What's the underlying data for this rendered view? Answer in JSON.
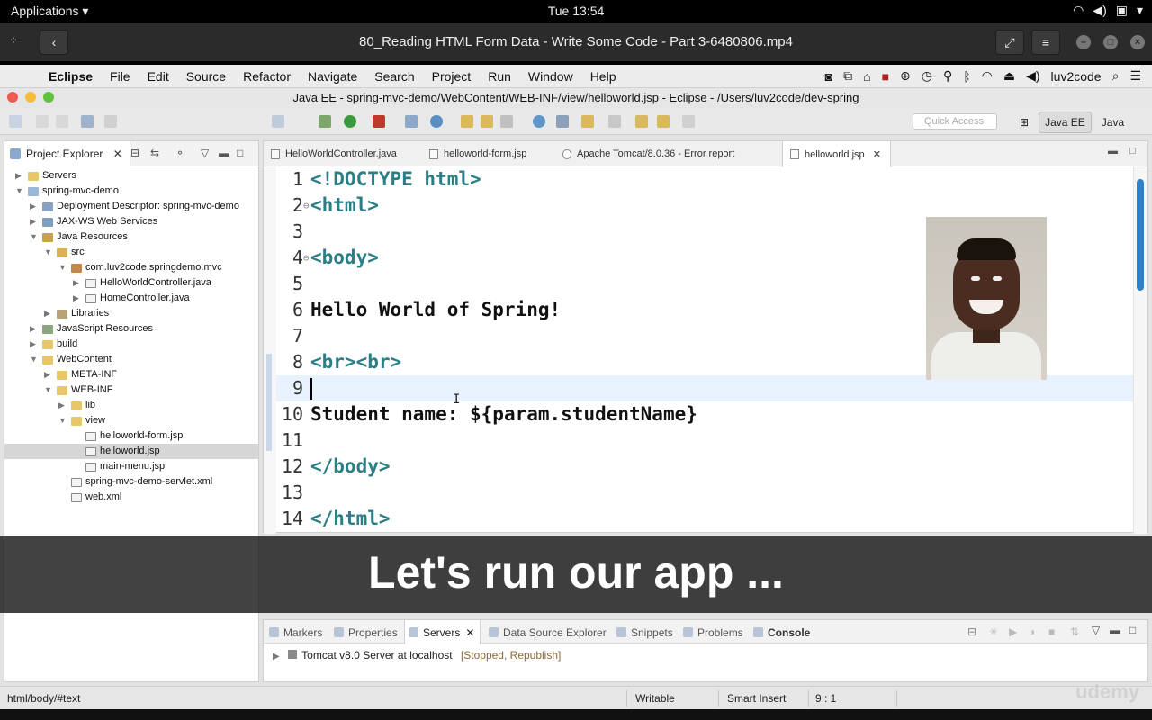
{
  "gnome": {
    "applications_label": "Applications ▾",
    "clock": "Tue 13:54",
    "tray_icons": [
      "wifi-icon",
      "volume-icon",
      "screen-share-icon",
      "power-icon"
    ]
  },
  "player": {
    "title": "80_Reading HTML Form Data - Write Some Code - Part 3-6480806.mp4",
    "back_glyph": "‹",
    "fullscreen_glyph": "⤢",
    "menu_glyph": "≡",
    "drag_glyph": "⁘"
  },
  "mac_menu": {
    "items": [
      "Eclipse",
      "File",
      "Edit",
      "Source",
      "Refactor",
      "Navigate",
      "Search",
      "Project",
      "Run",
      "Window",
      "Help"
    ],
    "user": "luv2code"
  },
  "eclipse": {
    "window_title": "Java EE - spring-mvc-demo/WebContent/WEB-INF/view/helloworld.jsp - Eclipse - /Users/luv2code/dev-spring",
    "quick_access_placeholder": "Quick Access",
    "perspectives": [
      "Java EE",
      "Java"
    ]
  },
  "project_explorer": {
    "tab_label": "Project Explorer",
    "close_glyph": "✕",
    "tree": [
      {
        "label": "Servers",
        "depth": 0,
        "arrow": "▶",
        "icon": "folder-icon"
      },
      {
        "label": "spring-mvc-demo",
        "depth": 0,
        "arrow": "▼",
        "icon": "project-icon"
      },
      {
        "label": "Deployment Descriptor: spring-mvc-demo",
        "depth": 1,
        "arrow": "▶",
        "icon": "descriptor-icon"
      },
      {
        "label": "JAX-WS Web Services",
        "depth": 1,
        "arrow": "▶",
        "icon": "webservice-icon"
      },
      {
        "label": "Java Resources",
        "depth": 1,
        "arrow": "▼",
        "icon": "java-resources-icon"
      },
      {
        "label": "src",
        "depth": 2,
        "arrow": "▼",
        "icon": "source-folder-icon"
      },
      {
        "label": "com.luv2code.springdemo.mvc",
        "depth": 3,
        "arrow": "▼",
        "icon": "package-icon"
      },
      {
        "label": "HelloWorldController.java",
        "depth": 4,
        "arrow": "▶",
        "icon": "java-file-icon"
      },
      {
        "label": "HomeController.java",
        "depth": 4,
        "arrow": "▶",
        "icon": "java-file-icon"
      },
      {
        "label": "Libraries",
        "depth": 2,
        "arrow": "▶",
        "icon": "library-icon"
      },
      {
        "label": "JavaScript Resources",
        "depth": 1,
        "arrow": "▶",
        "icon": "js-resources-icon"
      },
      {
        "label": "build",
        "depth": 1,
        "arrow": "▶",
        "icon": "folder-icon"
      },
      {
        "label": "WebContent",
        "depth": 1,
        "arrow": "▼",
        "icon": "folder-icon"
      },
      {
        "label": "META-INF",
        "depth": 2,
        "arrow": "▶",
        "icon": "folder-icon"
      },
      {
        "label": "WEB-INF",
        "depth": 2,
        "arrow": "▼",
        "icon": "folder-icon"
      },
      {
        "label": "lib",
        "depth": 3,
        "arrow": "▶",
        "icon": "folder-icon"
      },
      {
        "label": "view",
        "depth": 3,
        "arrow": "▼",
        "icon": "folder-icon"
      },
      {
        "label": "helloworld-form.jsp",
        "depth": 4,
        "arrow": "",
        "icon": "jsp-file-icon"
      },
      {
        "label": "helloworld.jsp",
        "depth": 4,
        "arrow": "",
        "icon": "jsp-file-icon",
        "selected": true
      },
      {
        "label": "main-menu.jsp",
        "depth": 4,
        "arrow": "",
        "icon": "jsp-file-icon"
      },
      {
        "label": "spring-mvc-demo-servlet.xml",
        "depth": 3,
        "arrow": "",
        "icon": "xml-file-icon"
      },
      {
        "label": "web.xml",
        "depth": 3,
        "arrow": "",
        "icon": "xml-file-icon"
      }
    ]
  },
  "editor": {
    "tabs": [
      {
        "label": "HelloWorldController.java",
        "active": false
      },
      {
        "label": "helloworld-form.jsp",
        "active": false
      },
      {
        "label": "Apache Tomcat/8.0.36 - Error report",
        "active": false
      },
      {
        "label": "helloworld.jsp",
        "active": true
      }
    ],
    "lines": [
      {
        "n": "1",
        "parts": [
          {
            "t": "<!DOCTYPE html>",
            "c": "tag"
          }
        ]
      },
      {
        "n": "2",
        "fold": true,
        "parts": [
          {
            "t": "<html>",
            "c": "tag"
          }
        ]
      },
      {
        "n": "3",
        "parts": []
      },
      {
        "n": "4",
        "fold": true,
        "parts": [
          {
            "t": "<body>",
            "c": "tag"
          }
        ]
      },
      {
        "n": "5",
        "parts": []
      },
      {
        "n": "6",
        "parts": [
          {
            "t": "Hello World of Spring!",
            "c": "txt"
          }
        ]
      },
      {
        "n": "7",
        "parts": []
      },
      {
        "n": "8",
        "parts": [
          {
            "t": "<br><br>",
            "c": "tag"
          }
        ]
      },
      {
        "n": "9",
        "current": true,
        "parts": []
      },
      {
        "n": "10",
        "parts": [
          {
            "t": "Student name: ",
            "c": "txt"
          },
          {
            "t": "${param.studentName}",
            "c": "txt"
          }
        ]
      },
      {
        "n": "11",
        "parts": []
      },
      {
        "n": "12",
        "parts": [
          {
            "t": "</body>",
            "c": "tag"
          }
        ]
      },
      {
        "n": "13",
        "parts": []
      },
      {
        "n": "14",
        "parts": [
          {
            "t": "</html>",
            "c": "tag"
          }
        ]
      }
    ]
  },
  "subtitle": "Let's run our app ...",
  "bottom_panel": {
    "tabs": [
      {
        "label": "Markers",
        "active": false,
        "bold": false
      },
      {
        "label": "Properties",
        "active": false,
        "bold": false
      },
      {
        "label": "Servers",
        "active": true,
        "bold": false
      },
      {
        "label": "Data Source Explorer",
        "active": false,
        "bold": false
      },
      {
        "label": "Snippets",
        "active": false,
        "bold": false
      },
      {
        "label": "Problems",
        "active": false,
        "bold": false
      },
      {
        "label": "Console",
        "active": false,
        "bold": true
      }
    ],
    "server_name": "Tomcat v8.0 Server at localhost",
    "server_status": "[Stopped, Republish]"
  },
  "status_bar": {
    "path": "html/body/#text",
    "writable": "Writable",
    "insert_mode": "Smart Insert",
    "position": "9 : 1"
  },
  "watermark": "udemy",
  "colors": {
    "tag": "#2a7f86",
    "accent": "#2f82c9",
    "selection": "#d6d6d6"
  }
}
